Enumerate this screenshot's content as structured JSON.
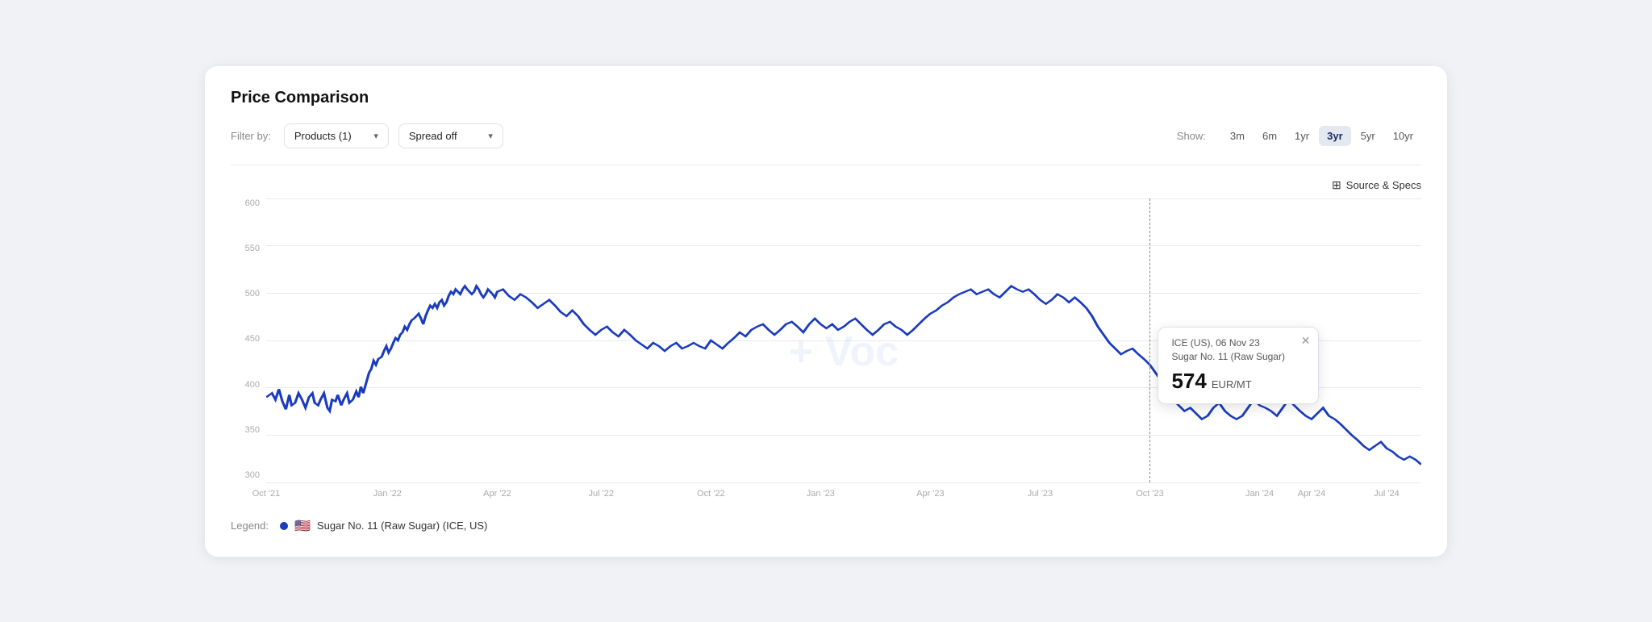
{
  "title": "Price Comparison",
  "filter": {
    "label": "Filter by:",
    "products_label": "Products (1)",
    "spread_label": "Spread off"
  },
  "show": {
    "label": "Show:",
    "options": [
      "3m",
      "6m",
      "1yr",
      "3yr",
      "5yr",
      "10yr"
    ],
    "active": "3yr"
  },
  "source_specs_label": "Source & Specs",
  "chart": {
    "watermark": "+ Voc",
    "y_labels": [
      "600",
      "550",
      "500",
      "450",
      "400",
      "350",
      "300"
    ],
    "y_values": [
      600,
      550,
      500,
      450,
      400,
      350,
      300
    ],
    "x_labels": [
      {
        "label": "Oct '21",
        "pct": 0
      },
      {
        "label": "Jan '22",
        "pct": 10.5
      },
      {
        "label": "Apr '22",
        "pct": 20
      },
      {
        "label": "Jul '22",
        "pct": 29
      },
      {
        "label": "Oct '22",
        "pct": 38.5
      },
      {
        "label": "Jan '23",
        "pct": 48
      },
      {
        "label": "Apr '23",
        "pct": 57.5
      },
      {
        "label": "Jul '23",
        "pct": 67
      },
      {
        "label": "Oct '23",
        "pct": 76.5
      },
      {
        "label": "Jan '24",
        "pct": 86
      },
      {
        "label": "Apr '24",
        "pct": 90.5
      },
      {
        "label": "Jul '24",
        "pct": 97
      }
    ],
    "tooltip": {
      "line_pct": 76.5,
      "title": "ICE (US), 06 Nov 23",
      "subtitle": "Sugar No. 11 (Raw Sugar)",
      "value": "574",
      "unit": "EUR/MT"
    }
  },
  "legend": {
    "prefix": "Legend:",
    "items": [
      {
        "label": "Sugar No. 11 (Raw Sugar) (ICE, US)",
        "flag": "🇺🇸"
      }
    ]
  }
}
